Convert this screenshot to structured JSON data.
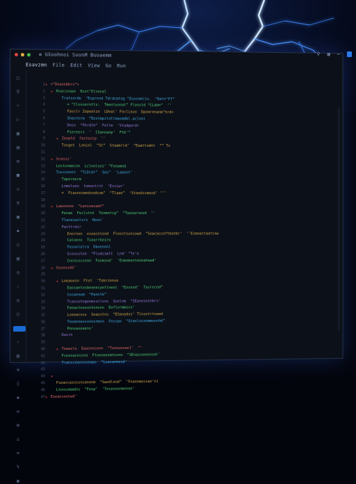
{
  "window": {
    "title_text": "≡ Gx̃oohnoi  SoonM  Buoaemm",
    "tab_text": "Esavzmn"
  },
  "menu": [
    "File",
    "Edit",
    "View",
    "Go",
    "Run"
  ],
  "sidebar_icons": [
    "file-icon",
    "search-icon",
    "branch-icon",
    "debug-icon",
    "extensions-icon",
    "folder-icon",
    "settings-icon",
    "doc-icon",
    "bookmark-icon",
    "list-icon",
    "grid-icon",
    "tag-icon",
    "pin-icon",
    "layers-icon",
    "clock-icon",
    "star-icon",
    "bell-icon",
    "user-icon",
    "cloud-icon",
    "code-icon",
    "chart-icon",
    "tool-icon",
    "key-icon",
    "lock-icon",
    "mail-icon",
    "gear-icon",
    "home-icon",
    "link-icon",
    "zap-icon",
    "eye-icon",
    "flag-icon",
    "box-icon",
    "map-icon",
    "cube-icon"
  ],
  "code_lines": [
    {
      "n": "1",
      "indent": 0,
      "fold": true,
      "text": "<\"Deaoobbrs”>",
      "color": "#e06a6a"
    },
    {
      "n": "2",
      "indent": 1,
      "fold": true,
      "text": "Rnaccenpe  Biet\"Elnenal",
      "color": "#4fc26b"
    },
    {
      "n": "3",
      "indent": 2,
      "fold": false,
      "text": "Tratsorde  \"Esprnnd Tdrdcmtng \"Esosnmllo.  “Détt\"Ff”",
      "color": "#3fb0e8"
    },
    {
      "n": "4",
      "indent": 3,
      "fold": false,
      "text": "= “Closserntls:  Tmentyonat” Flonstd “CLdd=”  ’’",
      "color": "#4fd07a"
    },
    {
      "n": "5",
      "indent": 3,
      "fold": false,
      "text": "Fasclr Zopeetin  LDeal’ Foclinzo  Dpomrenanm\"hrd>",
      "color": "#d4a94a"
    },
    {
      "n": "6",
      "indent": 3,
      "fold": false,
      "text": "Shasterm  “Eestmpilotlmasmdbl.aclnnl",
      "color": "#3fb0e8"
    },
    {
      "n": "7",
      "indent": 3,
      "fold": false,
      "text": "Deos  “Phrdlh”  Fellm  ‘Stadpwrd>",
      "color": "#9a7be0"
    },
    {
      "n": "8",
      "indent": 3,
      "fold": false,
      "text": "Piereers  ’  CSaneanp’  Ftb’”",
      "color": "#4fd07a"
    },
    {
      "n": "9",
      "indent": 2,
      "fold": true,
      "text": "Zeoptd  fastestp  ’’",
      "color": "#e06a6a"
    },
    {
      "n": "10",
      "indent": 2,
      "fold": false,
      "text": "Tosgnt  Lnniel  “St”  Staamrld’  “Eaattsmhl  ”” Ts",
      "color": "#d4a94a"
    },
    {
      "n": "11",
      "indent": 0,
      "fold": false,
      "text": "",
      "color": "#4fd07a"
    },
    {
      "n": "12",
      "indent": 1,
      "fold": true,
      "text": "Scenss’",
      "color": "#e06a6a"
    },
    {
      "n": "13",
      "indent": 1,
      "fold": false,
      "text": "Lestonmecnn  Lclneloss’ “Foeamnd",
      "color": "#4fd07a"
    },
    {
      "n": "14",
      "indent": 1,
      "fold": false,
      "text": "Tusconnet  “TLDcdr”  Sas”  ‘Laaont’",
      "color": "#3fb0e8"
    },
    {
      "n": "15",
      "indent": 2,
      "fold": false,
      "text": "Tapereerm",
      "color": "#4fd07a"
    },
    {
      "n": "16",
      "indent": 2,
      "fold": false,
      "text": "Lnmoleeo  tomontrst  ‘Essiwr’",
      "color": "#9a7be0"
    },
    {
      "n": "17",
      "indent": 2,
      "fold": false,
      "text": "=  Fiasnosmedsndssm”  “Tlaae”  ‘Staedssmasd’ ’’’",
      "color": "#d4a94a"
    },
    {
      "n": "18",
      "indent": 0,
      "fold": false,
      "text": "",
      "color": "#4fd07a"
    },
    {
      "n": "19",
      "indent": 1,
      "fold": true,
      "text": "Laaseene  “Lansoasamf”",
      "color": "#e06a6a"
    },
    {
      "n": "20",
      "indent": 2,
      "fold": false,
      "text": "Peoae  Feclstnt  Tenmntcg”  “Tauoarneed  ’’",
      "color": "#4fd07a"
    },
    {
      "n": "21",
      "indent": 2,
      "fold": false,
      "text": "Tlasaiaslsrs  Heoo’",
      "color": "#3fb0e8"
    },
    {
      "n": "22",
      "indent": 2,
      "fold": false,
      "text": "Pasttrmir",
      "color": "#9a7be0"
    },
    {
      "n": "23",
      "indent": 3,
      "fold": false,
      "text": "Enornen  eseacnlend  Fleostsuniowd  “Soacassoftmshbr’  ’’Esmoastaatinw",
      "color": "#d4a94a"
    },
    {
      "n": "24",
      "indent": 3,
      "fold": false,
      "text": "Caloens  Tiearrkeiro",
      "color": "#4fd07a"
    },
    {
      "n": "25",
      "indent": 3,
      "fold": false,
      "text": "Fesnnlelra  Dkoennnl",
      "color": "#3fb0e8"
    },
    {
      "n": "26",
      "indent": 3,
      "fold": false,
      "text": "Sconsstnn  “Flodssmlt  Lnd’ “Te’e",
      "color": "#9a7be0"
    },
    {
      "n": "27",
      "indent": 3,
      "fold": false,
      "text": "Cncnssssnnn  Fonmsnd’  ’Eomnmenteeeahaad’",
      "color": "#4fd07a"
    },
    {
      "n": "28",
      "indent": 1,
      "fold": true,
      "text": "Sosensdd’",
      "color": "#e06a6a"
    },
    {
      "n": "29",
      "indent": 0,
      "fold": false,
      "text": "",
      "color": "#4fd07a"
    },
    {
      "n": "30",
      "indent": 2,
      "fold": true,
      "text": "Loeaoesn  Ftst  ‘Tobrinnse",
      "color": "#d4a94a"
    },
    {
      "n": "31",
      "indent": 3,
      "fold": false,
      "text": "Eassaetosbeonecyetlneel  “Eoseod’  Tasrecnd”",
      "color": "#4fd07a"
    },
    {
      "n": "32",
      "indent": 3,
      "fold": false,
      "text": "Cosannom  “Pannlk”",
      "color": "#3fb0e8"
    },
    {
      "n": "33",
      "indent": 3,
      "fold": false,
      "text": "Tcassotngenmssclsns  Seelnm  “SEanesnntbrs’",
      "color": "#9a7be0"
    },
    {
      "n": "34",
      "indent": 3,
      "fold": false,
      "text": "Feeastnossntnnsnn  Eoflormmscn’",
      "color": "#4fd07a"
    },
    {
      "n": "35",
      "indent": 3,
      "fold": false,
      "text": "Lseeacsss  Soasstns  “ESanadss’ Tlnsotrtnaed",
      "color": "#d4a94a"
    },
    {
      "n": "36",
      "indent": 3,
      "fold": false,
      "text": "Teoannasssnosnmsn  Fnsspo  “Stanlnssnmmsnnhd”",
      "color": "#3fb0e8"
    },
    {
      "n": "37",
      "indent": 3,
      "fold": false,
      "text": "Ponsaseaens’",
      "color": "#4fd07a"
    },
    {
      "n": "38",
      "indent": 2,
      "fold": false,
      "text": "Dasrn",
      "color": "#9a7be0"
    },
    {
      "n": "39",
      "indent": 0,
      "fold": false,
      "text": "",
      "color": "#4fd07a"
    },
    {
      "n": "40",
      "indent": 2,
      "fold": true,
      "text": "Teaaslo  Eaasnnsonn  “Tonnuenanl’  ”’",
      "color": "#e06a6a"
    },
    {
      "n": "41",
      "indent": 2,
      "fold": false,
      "text": "Fcesnasnssno  Ftoeoeenmtnsnn  “SEnasseeennsh’",
      "color": "#4fd07a"
    },
    {
      "n": "42",
      "indent": 2,
      "fold": false,
      "text": "Tcansceasnsseaas  “Loasanmeod’",
      "color": "#3fb0e8"
    },
    {
      "n": "43",
      "indent": 1,
      "fold": false,
      "text": "",
      "color": "#4fd07a"
    },
    {
      "n": "44",
      "indent": 1,
      "fold": true,
      "text": "",
      "color": "#e06a6a"
    },
    {
      "n": "45",
      "indent": 1,
      "fold": false,
      "text": "Fseancasnssnsanonm  “Saedlnnd”  ‘Foannmessan’nl",
      "color": "#d4a94a"
    },
    {
      "n": "46",
      "indent": 1,
      "fold": false,
      "text": "Ltonsomadns  “Fesp’  ’Tesenoonmnnee’",
      "color": "#4fd07a"
    },
    {
      "n": "47",
      "indent": 0,
      "fold": true,
      "text": "Eoeanseenwd’",
      "color": "#e06a6a"
    }
  ]
}
